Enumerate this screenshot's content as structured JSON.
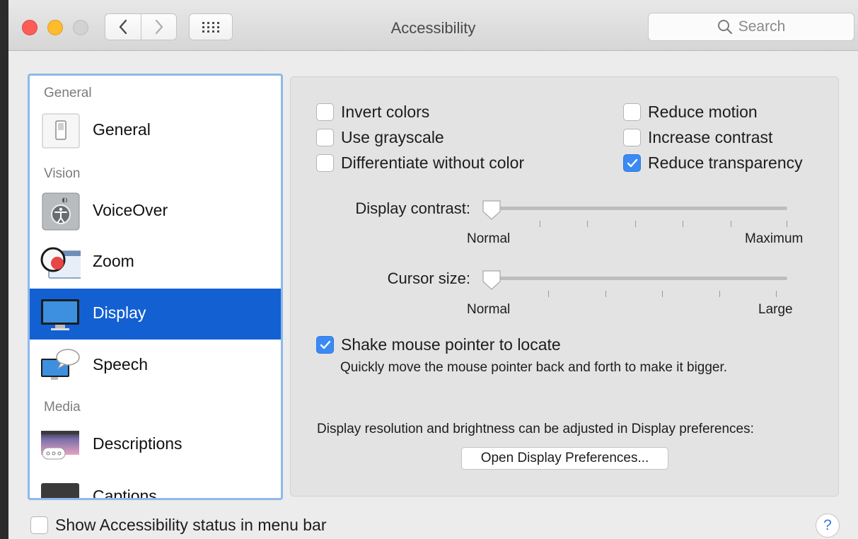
{
  "window": {
    "title": "Accessibility"
  },
  "search": {
    "placeholder": "Search"
  },
  "sidebar": {
    "sections": [
      {
        "title": "General"
      },
      {
        "title": "Vision"
      },
      {
        "title": "Media"
      }
    ],
    "items": [
      {
        "label": "General",
        "icon": "switch-icon"
      },
      {
        "label": "VoiceOver",
        "icon": "voiceover-icon"
      },
      {
        "label": "Zoom",
        "icon": "magnifier-icon"
      },
      {
        "label": "Display",
        "icon": "monitor-icon",
        "selected": true
      },
      {
        "label": "Speech",
        "icon": "speech-bubble-icon"
      },
      {
        "label": "Descriptions",
        "icon": "descriptions-icon"
      },
      {
        "label": "Captions",
        "icon": "captions-icon"
      }
    ]
  },
  "display": {
    "checkboxes": [
      {
        "label": "Invert colors",
        "checked": false
      },
      {
        "label": "Use grayscale",
        "checked": false
      },
      {
        "label": "Differentiate without color",
        "checked": false
      },
      {
        "label": "Reduce motion",
        "checked": false
      },
      {
        "label": "Increase contrast",
        "checked": false
      },
      {
        "label": "Reduce transparency",
        "checked": true
      }
    ],
    "contrast": {
      "label": "Display contrast:",
      "min_label": "Normal",
      "max_label": "Maximum",
      "value": 0
    },
    "cursor": {
      "label": "Cursor size:",
      "min_label": "Normal",
      "max_label": "Large",
      "value": 0
    },
    "shake": {
      "label": "Shake mouse pointer to locate",
      "checked": true,
      "description": "Quickly move the mouse pointer back and forth to make it bigger."
    },
    "resolution_note": "Display resolution and brightness can be adjusted in Display preferences:",
    "open_button": "Open Display Preferences..."
  },
  "footer": {
    "status_label": "Show Accessibility status in menu bar",
    "status_checked": false,
    "help": "?"
  },
  "colors": {
    "accent": "#3a8af4",
    "selection": "#1360d3",
    "sidebar_focus": "#8fb8ea"
  }
}
